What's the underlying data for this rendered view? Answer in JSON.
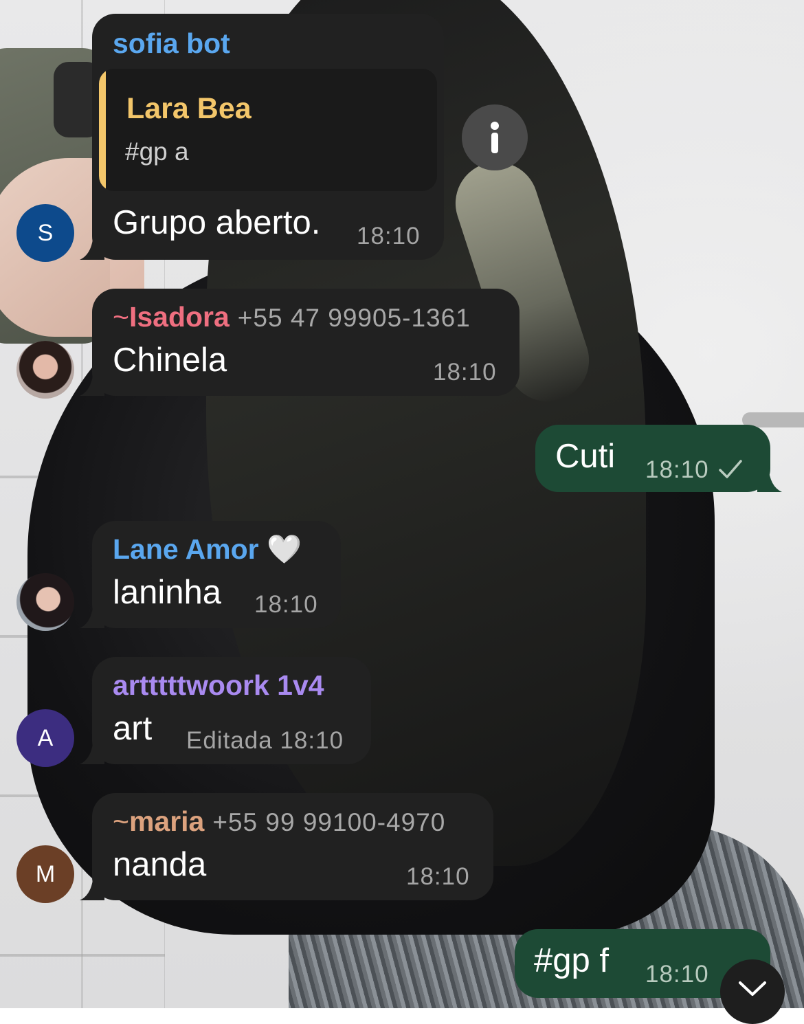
{
  "messages": [
    {
      "sender": "sofia bot",
      "sender_color": "#5aa7ef",
      "avatar_letter": "S",
      "avatar_color": "#0d4a8c",
      "reply": {
        "name": "Lara Bea",
        "text": "#gp a"
      },
      "text": "Grupo aberto.",
      "time": "18:10"
    },
    {
      "tilde": "~",
      "sender": "Isadora",
      "sender_color": "#ef6f80",
      "phone": "+55 47 99905-1361",
      "text": "Chinela",
      "time": "18:10"
    },
    {
      "outgoing": true,
      "text": "Cuti",
      "time": "18:10",
      "status_icon": "check-icon"
    },
    {
      "sender": "Lane Amor 🤍",
      "sender_color": "#5aa7ef",
      "text": "laninha",
      "time": "18:10"
    },
    {
      "sender": "artttttwoork 1v4",
      "sender_color": "#a98af0",
      "avatar_letter": "A",
      "avatar_color": "#3c2d80",
      "text": "art",
      "edited": "Editada",
      "time": "18:10"
    },
    {
      "tilde": "~",
      "sender": "maria",
      "sender_color": "#dca27e",
      "phone": "+55 99 99100-4970",
      "avatar_letter": "M",
      "avatar_color": "#6b3f26",
      "text": "nanda",
      "time": "18:10"
    },
    {
      "outgoing": true,
      "text": "#gp f",
      "time": "18:10"
    }
  ],
  "icons": {
    "info": "info-icon",
    "scroll_down": "chevron-down-icon"
  }
}
